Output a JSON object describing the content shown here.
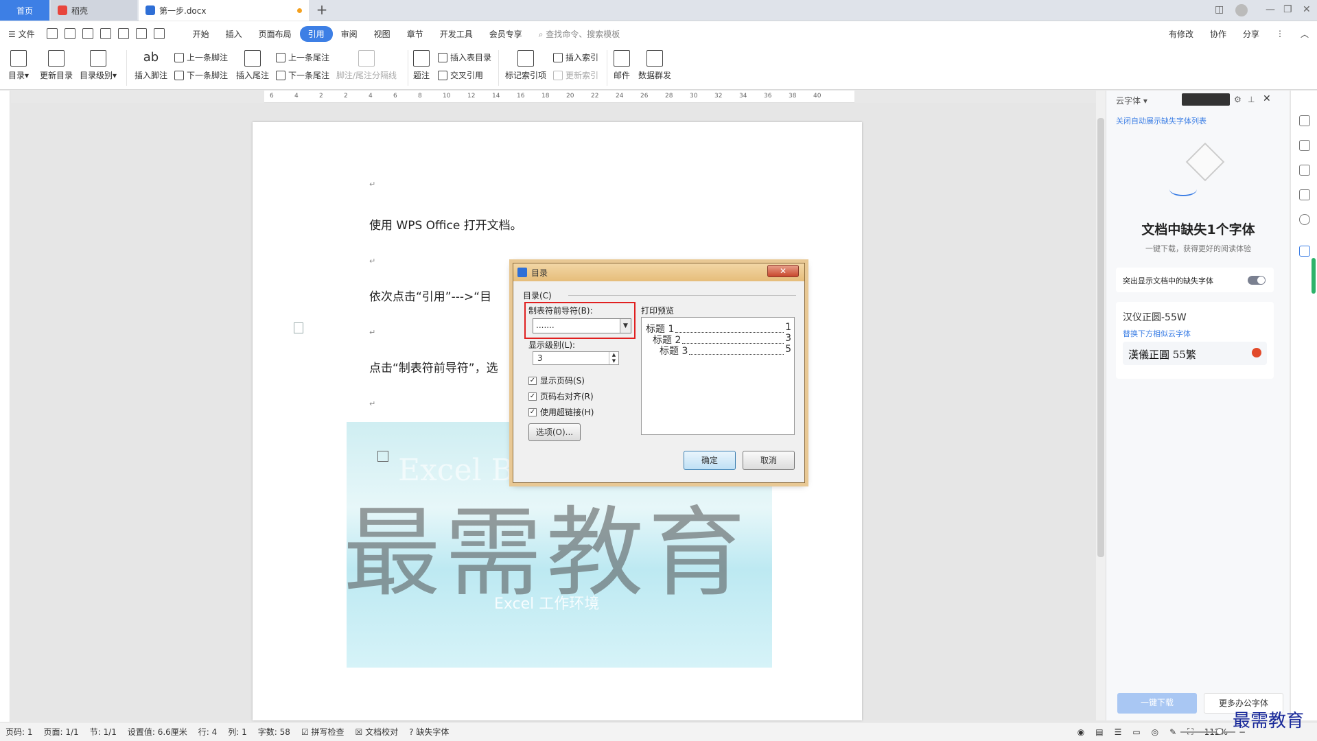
{
  "tabs": {
    "home": "首页",
    "shell": "稻壳",
    "doc": "第一步.docx"
  },
  "menu": {
    "file": "文件",
    "items": [
      "开始",
      "插入",
      "页面布局",
      "引用",
      "审阅",
      "视图",
      "章节",
      "开发工具",
      "会员专享"
    ],
    "active": "引用",
    "search": "查找命令、搜索模板",
    "right": [
      "有修改",
      "协作",
      "分享"
    ]
  },
  "ribbon": {
    "toc": "目录",
    "update_toc": "更新目录",
    "toc_level": "目录级别",
    "insert_footnote": "插入脚注",
    "prev_footnote": "上一条脚注",
    "next_footnote": "下一条脚注",
    "insert_endnote": "插入尾注",
    "prev_endnote": "上一条尾注",
    "next_endnote": "下一条尾注",
    "footnote_separator": "脚注/尾注分隔线",
    "caption": "题注",
    "insert_table_of_figures": "插入表目录",
    "cross_reference": "交叉引用",
    "mark_index": "标记索引项",
    "insert_index": "插入索引",
    "update_index": "更新索引",
    "mail": "邮件",
    "mail_merge": "数据群发"
  },
  "ruler_marks": [
    "6",
    "4",
    "2",
    "2",
    "4",
    "6",
    "8",
    "10",
    "12",
    "14",
    "16",
    "18",
    "20",
    "22",
    "24",
    "26",
    "28",
    "30",
    "32",
    "34",
    "36",
    "38",
    "40"
  ],
  "document": {
    "p1": "使用 WPS Office 打开文档。",
    "p2": "依次点击“引用”--->“目",
    "p3": "点击“制表符前导符”，选",
    "watermark": "最需教育",
    "img_text1": "Excel Books",
    "img_text2": "Excel 工作环境",
    "para_mark": "↵"
  },
  "dialog": {
    "title": "目录",
    "group": "目录(C)",
    "leader_label": "制表符前导符(B):",
    "leader_value": ".......",
    "level_label": "显示级别(L):",
    "level_value": "3",
    "show_page": "显示页码(S)",
    "right_align": "页码右对齐(R)",
    "hyperlink": "使用超链接(H)",
    "options": "选项(O)...",
    "preview_label": "打印预览",
    "preview": [
      {
        "text": "标题 1",
        "page": "1"
      },
      {
        "text": "标题 2",
        "page": "3"
      },
      {
        "text": "标题 3",
        "page": "5"
      }
    ],
    "ok": "确定",
    "cancel": "取消"
  },
  "panel": {
    "title": "云字体",
    "link": "关闭自动展示缺失字体列表",
    "heading": "文档中缺失1个字体",
    "sub": "一键下载，获得更好的阅读体验",
    "toggle_label": "突出显示文档中的缺失字体",
    "font_name": "汉仪正圆-55W",
    "replace_hint": "替换下方相似云字体",
    "font_sample": "漢儀正圓 55繁",
    "download": "一键下载",
    "more": "更多办公字体"
  },
  "status": {
    "page": "页码: 1",
    "pages": "页面: 1/1",
    "section": "节: 1/1",
    "setting": "设置值: 6.6厘米",
    "row": "行: 4",
    "col": "列: 1",
    "words": "字数: 58",
    "spell": "拼写检查",
    "proof": "文档校对",
    "missing_font": "缺失字体",
    "zoom": "112%"
  },
  "brand": "最需教育",
  "colors": {
    "accent": "#3d7fe5",
    "highlight": "#e02020"
  }
}
